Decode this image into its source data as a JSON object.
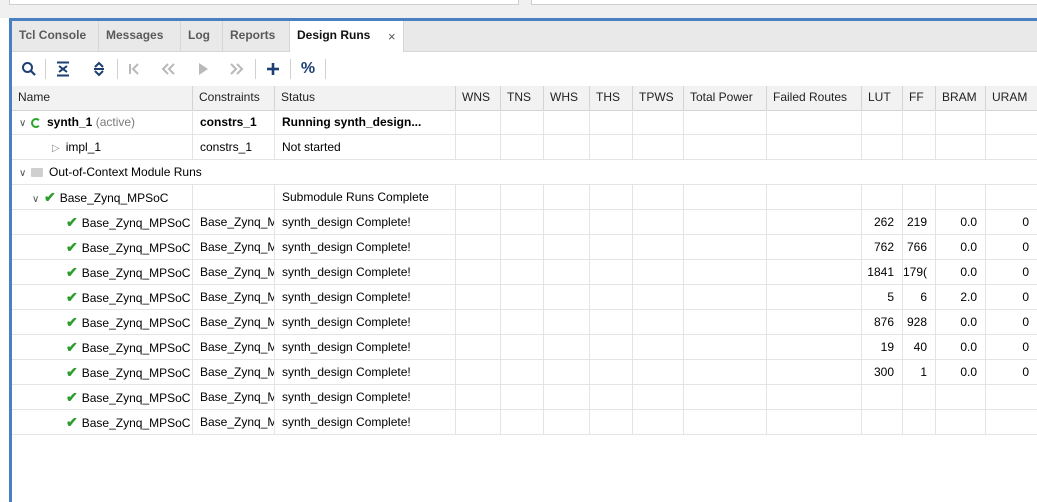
{
  "tabs": [
    {
      "label": "Tcl Console"
    },
    {
      "label": "Messages"
    },
    {
      "label": "Log"
    },
    {
      "label": "Reports"
    },
    {
      "label": "Design Runs"
    }
  ],
  "close_glyph": "×",
  "toolbar_icons": [
    "search-icon",
    "collapse-all-icon",
    "expand-all-icon",
    "first-icon",
    "previous-icon",
    "next-icon",
    "last-icon",
    "add-icon",
    "percent-icon"
  ],
  "percent_label": "%",
  "columns": [
    "Name",
    "Constraints",
    "Status",
    "WNS",
    "TNS",
    "WHS",
    "THS",
    "TPWS",
    "Total Power",
    "Failed Routes",
    "LUT",
    "FF",
    "BRAM",
    "URAM"
  ],
  "synth": {
    "name": "synth_1",
    "tag": "(active)",
    "constraints": "constrs_1",
    "status": "Running synth_design..."
  },
  "impl": {
    "name": "impl_1",
    "constraints": "constrs_1",
    "status": "Not started"
  },
  "ooc_group": {
    "label": "Out-of-Context Module Runs"
  },
  "parent": {
    "name": "Base_Zynq_MPSoC",
    "status": "Submodule Runs Complete"
  },
  "sub_runs": [
    {
      "name": "Base_Zynq_MPSoC",
      "constraints": "Base_Zynq_M",
      "status": "synth_design Complete!",
      "lut": "262",
      "ff": "219",
      "bram": "0.0",
      "uram": "0"
    },
    {
      "name": "Base_Zynq_MPSoC",
      "constraints": "Base_Zynq_M",
      "status": "synth_design Complete!",
      "lut": "762",
      "ff": "766",
      "bram": "0.0",
      "uram": "0"
    },
    {
      "name": "Base_Zynq_MPSoC",
      "constraints": "Base_Zynq_M",
      "status": "synth_design Complete!",
      "lut": "1841",
      "ff": "179(",
      "bram": "0.0",
      "uram": "0"
    },
    {
      "name": "Base_Zynq_MPSoC",
      "constraints": "Base_Zynq_M",
      "status": "synth_design Complete!",
      "lut": "5",
      "ff": "6",
      "bram": "2.0",
      "uram": "0"
    },
    {
      "name": "Base_Zynq_MPSoC",
      "constraints": "Base_Zynq_M",
      "status": "synth_design Complete!",
      "lut": "876",
      "ff": "928",
      "bram": "0.0",
      "uram": "0"
    },
    {
      "name": "Base_Zynq_MPSoC",
      "constraints": "Base_Zynq_M",
      "status": "synth_design Complete!",
      "lut": "19",
      "ff": "40",
      "bram": "0.0",
      "uram": "0"
    },
    {
      "name": "Base_Zynq_MPSoC",
      "constraints": "Base_Zynq_M",
      "status": "synth_design Complete!",
      "lut": "300",
      "ff": "1",
      "bram": "0.0",
      "uram": "0"
    },
    {
      "name": "Base_Zynq_MPSoC",
      "constraints": "Base_Zynq_M",
      "status": "synth_design Complete!",
      "lut": "",
      "ff": "",
      "bram": "",
      "uram": ""
    },
    {
      "name": "Base_Zynq_MPSoC",
      "constraints": "Base_Zynq_M",
      "status": "synth_design Complete!",
      "lut": "",
      "ff": "",
      "bram": "",
      "uram": ""
    }
  ],
  "colors": {
    "accent": "#4b7fc4",
    "check": "#2a9d2a"
  }
}
